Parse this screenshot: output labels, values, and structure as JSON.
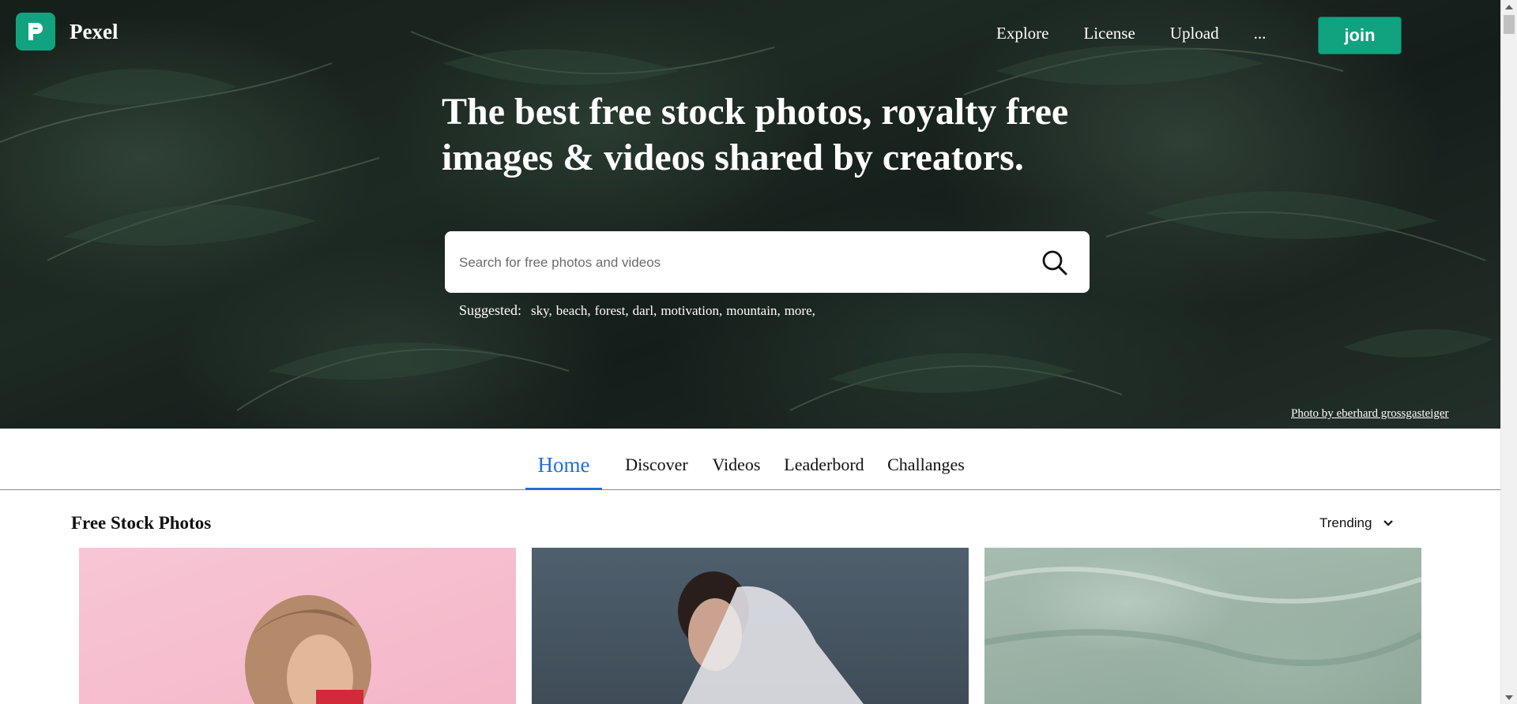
{
  "brand": {
    "name": "Pexel",
    "logo_icon": "pexels-logo-icon",
    "accent": "#11a37f"
  },
  "topnav": {
    "links": [
      "Explore",
      "License",
      "Upload",
      "..."
    ],
    "join_label": "join"
  },
  "hero": {
    "title": "The best free stock photos, royalty free images & videos shared by creators.",
    "search": {
      "placeholder": "Search for free photos and videos",
      "value": "",
      "icon": "search-icon"
    },
    "suggested_label": "Suggested:",
    "suggested_tags": [
      "sky,",
      "beach,",
      "forest,",
      "darl,",
      "motivation,",
      "mountain,",
      "more,"
    ],
    "photo_credit": "Photo by eberhard grossgasteiger"
  },
  "tabs": {
    "items": [
      "Home",
      "Discover",
      "Videos",
      "Leaderbord",
      "Challanges"
    ],
    "active": "Home",
    "active_color": "#1f6fe0"
  },
  "content": {
    "section_title": "Free Stock Photos",
    "sort": {
      "selected": "Trending",
      "icon": "chevron-down-icon"
    }
  }
}
